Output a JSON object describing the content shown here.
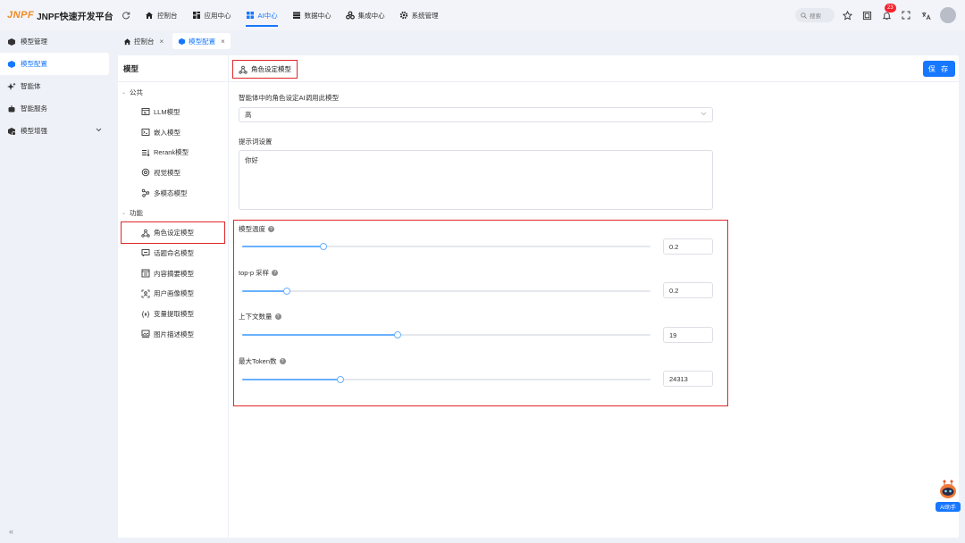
{
  "brand": {
    "logo_mark": "JNPF",
    "name": "JNPF快速开发平台"
  },
  "topnav": [
    {
      "label": "控制台",
      "icon": "home-icon",
      "active": false
    },
    {
      "label": "应用中心",
      "icon": "app-icon",
      "active": false
    },
    {
      "label": "AI中心",
      "icon": "ai-grid-icon",
      "active": true
    },
    {
      "label": "数据中心",
      "icon": "database-icon",
      "active": false
    },
    {
      "label": "集成中心",
      "icon": "integration-icon",
      "active": false
    },
    {
      "label": "系统管理",
      "icon": "settings-icon",
      "active": false
    }
  ],
  "search": {
    "placeholder": "搜索"
  },
  "notifications": {
    "count": "23"
  },
  "sidebar": {
    "items": [
      {
        "label": "模型管理",
        "icon": "model-icon",
        "active": false
      },
      {
        "label": "模型配置",
        "icon": "model-config-icon",
        "active": true
      },
      {
        "label": "智能体",
        "icon": "sparkle-icon",
        "active": false
      },
      {
        "label": "智能服务",
        "icon": "robot-icon",
        "active": false
      },
      {
        "label": "模型增强",
        "icon": "enhance-icon",
        "active": false
      }
    ],
    "collapse": "«"
  },
  "tabs": [
    {
      "label": "控制台",
      "close": "×"
    },
    {
      "label": "模型配置",
      "close": "×"
    }
  ],
  "tree": {
    "title": "模型",
    "groups": [
      {
        "label": "公共",
        "items": [
          "LLM模型",
          "嵌入模型",
          "Rerank模型",
          "视觉模型",
          "多模态模型"
        ]
      },
      {
        "label": "功能",
        "items": [
          "角色设定模型",
          "话题命名模型",
          "内容摘要模型",
          "用户画像模型",
          "变量提取模型",
          "图片描述模型"
        ]
      }
    ],
    "selected": "角色设定模型"
  },
  "content": {
    "title": "角色设定模型",
    "save_label": "保 存",
    "model_label": "智能体中的角色设定AI调用此模型",
    "model_value": "高",
    "prompt_label": "提示词设置",
    "prompt_value": "你好",
    "params": [
      {
        "label": "模型温度",
        "value": "0.2",
        "fraction": 0.2
      },
      {
        "label": "top-p 采样",
        "value": "0.2",
        "fraction": 0.11
      },
      {
        "label": "上下文数量",
        "value": "19",
        "fraction": 0.38
      },
      {
        "label": "最大Token数",
        "value": "24313",
        "fraction": 0.24
      }
    ],
    "help_glyph": "?"
  },
  "ai_assistant": {
    "label": "AI助手"
  },
  "colors": {
    "accent": "#1677ff",
    "highlight_box": "#e0262a",
    "slider_fill": "#69b1ff"
  }
}
